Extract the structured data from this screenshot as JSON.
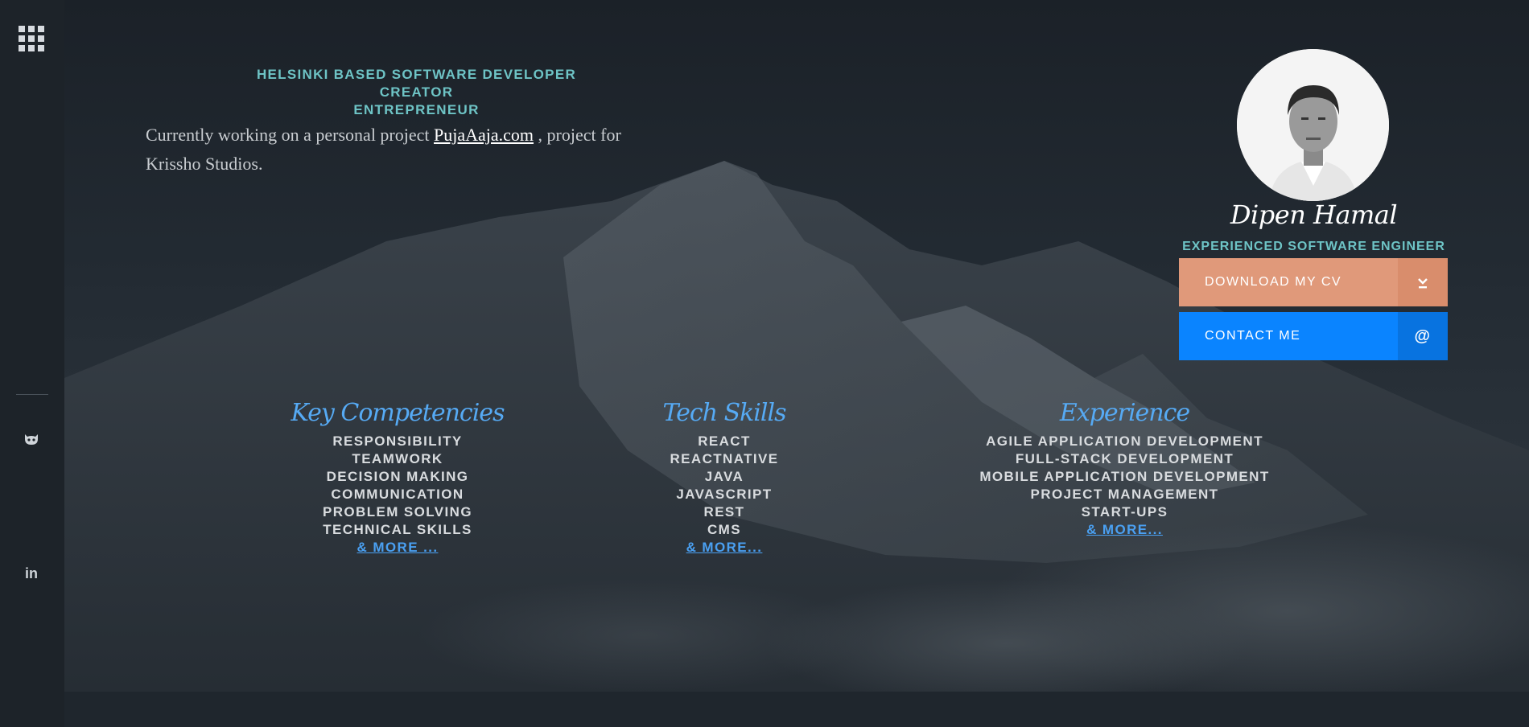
{
  "sidebar": {
    "menu_icon": "grid-menu-icon",
    "social": [
      {
        "icon": "github-icon"
      },
      {
        "icon": "linkedin-icon",
        "glyph": "in"
      }
    ]
  },
  "intro": {
    "tagline": [
      "HELSINKI BASED SOFTWARE DEVELOPER",
      "CREATOR",
      "ENTREPRENEUR"
    ],
    "text_before": "Currently working on a personal project ",
    "link_text": "PujaAaja.com",
    "text_after": " , project for Krissho Studios."
  },
  "profile": {
    "name": "Dipen Hamal",
    "role": "EXPERIENCED SOFTWARE ENGINEER",
    "cv_button": "DOWNLOAD MY CV",
    "cv_icon": "download-icon",
    "contact_button": "CONTACT ME",
    "contact_icon_glyph": "@"
  },
  "sections": [
    {
      "title": "Key Competencies",
      "items": [
        "RESPONSIBILITY",
        "TEAMWORK",
        "DECISION MAKING",
        "COMMUNICATION",
        "PROBLEM SOLVING",
        "TECHNICAL SKILLS"
      ],
      "more": "& MORE ..."
    },
    {
      "title": "Tech Skills",
      "items": [
        "REACT",
        "REACTNATIVE",
        "JAVA",
        "JAVASCRIPT",
        "REST",
        "CMS"
      ],
      "more": "& MORE..."
    },
    {
      "title": "Experience",
      "items": [
        "AGILE APPLICATION DEVELOPMENT",
        "FULL-STACK DEVELOPMENT",
        "MOBILE APPLICATION DEVELOPMENT",
        "PROJECT MANAGEMENT",
        "START-UPS"
      ],
      "more": "& MORE..."
    }
  ],
  "colors": {
    "accent_teal": "#6ec4c6",
    "heading_blue": "#56aaf4",
    "cv_orange": "#e0997a",
    "contact_blue": "#0a84ff"
  }
}
